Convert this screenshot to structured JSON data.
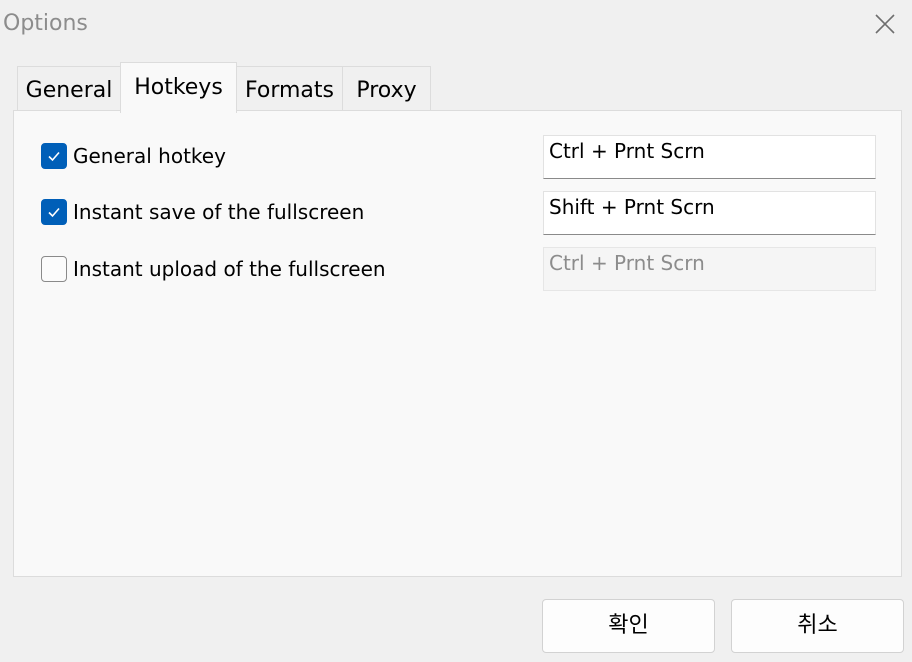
{
  "window": {
    "title": "Options"
  },
  "tabs": [
    {
      "label": "General",
      "active": false
    },
    {
      "label": "Hotkeys",
      "active": true
    },
    {
      "label": "Formats",
      "active": false
    },
    {
      "label": "Proxy",
      "active": false
    }
  ],
  "hotkeys": [
    {
      "label": "General hotkey",
      "checked": true,
      "value": "Ctrl + Prnt Scrn",
      "enabled": true
    },
    {
      "label": "Instant save of the fullscreen",
      "checked": true,
      "value": "Shift + Prnt Scrn",
      "enabled": true
    },
    {
      "label": "Instant upload of the fullscreen",
      "checked": false,
      "value": "Ctrl + Prnt Scrn",
      "enabled": false
    }
  ],
  "buttons": {
    "ok_label": "확인",
    "cancel_label": "취소"
  },
  "colors": {
    "accent": "#005fb8",
    "title_text": "#8c8c8c",
    "window_bg": "#f0f0f0",
    "panel_bg": "#f9f9f9"
  },
  "icons": {
    "close": "close-icon",
    "check": "checkmark-icon"
  }
}
